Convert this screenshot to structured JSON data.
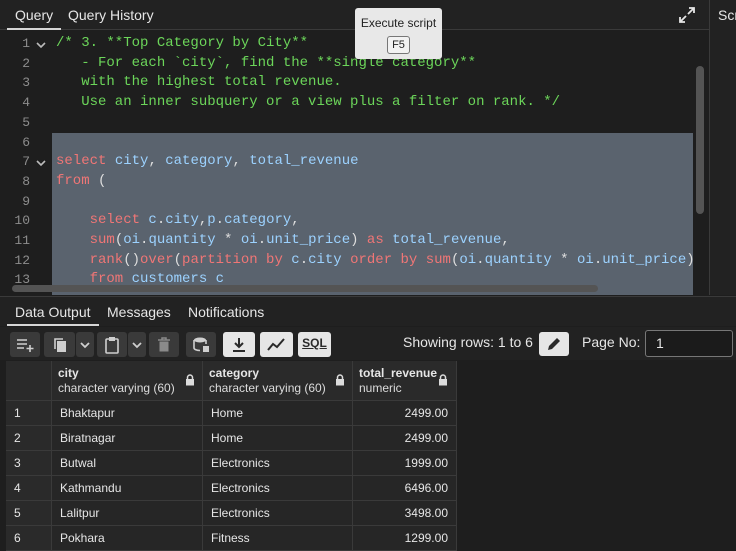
{
  "tabs": {
    "query": "Query",
    "history": "Query History",
    "right_partial": "Scratch"
  },
  "tooltip": {
    "text": "Execute script",
    "key": "F5"
  },
  "editor": {
    "line_numbers": [
      "1",
      "2",
      "3",
      "4",
      "5",
      "6",
      "7",
      "8",
      "9",
      "10",
      "11",
      "12",
      "13"
    ],
    "lines": [
      [
        {
          "t": "/* 3. **Top Category by City**",
          "c": "cmt"
        }
      ],
      [
        {
          "t": "   - For each `city`, find the **single category**",
          "c": "cmt"
        }
      ],
      [
        {
          "t": "   with the highest total revenue.",
          "c": "cmt"
        }
      ],
      [
        {
          "t": "   Use an inner subquery or a view plus a filter on rank. */",
          "c": "cmt"
        }
      ],
      [],
      [],
      [
        {
          "t": "select",
          "c": "kw"
        },
        {
          "t": " city",
          "c": "id"
        },
        {
          "t": ",",
          "c": "pn"
        },
        {
          "t": " category",
          "c": "id"
        },
        {
          "t": ",",
          "c": "pn"
        },
        {
          "t": " total_revenue",
          "c": "id"
        }
      ],
      [
        {
          "t": "from",
          "c": "kw"
        },
        {
          "t": " (",
          "c": "pn"
        }
      ],
      [],
      [
        {
          "t": "    select",
          "c": "kw"
        },
        {
          "t": " c",
          "c": "id"
        },
        {
          "t": ".",
          "c": "pn"
        },
        {
          "t": "city",
          "c": "id"
        },
        {
          "t": ",",
          "c": "pn"
        },
        {
          "t": "p",
          "c": "id"
        },
        {
          "t": ".",
          "c": "pn"
        },
        {
          "t": "category",
          "c": "id"
        },
        {
          "t": ",",
          "c": "pn"
        }
      ],
      [
        {
          "t": "    sum",
          "c": "kw"
        },
        {
          "t": "(",
          "c": "pn"
        },
        {
          "t": "oi",
          "c": "id"
        },
        {
          "t": ".",
          "c": "pn"
        },
        {
          "t": "quantity",
          "c": "id"
        },
        {
          "t": " * ",
          "c": "pn"
        },
        {
          "t": "oi",
          "c": "id"
        },
        {
          "t": ".",
          "c": "pn"
        },
        {
          "t": "unit_price",
          "c": "id"
        },
        {
          "t": ") ",
          "c": "pn"
        },
        {
          "t": "as",
          "c": "kw"
        },
        {
          "t": " total_revenue",
          "c": "id"
        },
        {
          "t": ",",
          "c": "pn"
        }
      ],
      [
        {
          "t": "    rank",
          "c": "kw"
        },
        {
          "t": "()",
          "c": "pn"
        },
        {
          "t": "over",
          "c": "kw"
        },
        {
          "t": "(",
          "c": "pn"
        },
        {
          "t": "partition by",
          "c": "kw"
        },
        {
          "t": " c",
          "c": "id"
        },
        {
          "t": ".",
          "c": "pn"
        },
        {
          "t": "city",
          "c": "id"
        },
        {
          "t": " order by",
          "c": "kw"
        },
        {
          "t": " sum",
          "c": "kw"
        },
        {
          "t": "(",
          "c": "pn"
        },
        {
          "t": "oi",
          "c": "id"
        },
        {
          "t": ".",
          "c": "pn"
        },
        {
          "t": "quantity",
          "c": "id"
        },
        {
          "t": " * ",
          "c": "pn"
        },
        {
          "t": "oi",
          "c": "id"
        },
        {
          "t": ".",
          "c": "pn"
        },
        {
          "t": "unit_price",
          "c": "id"
        },
        {
          "t": ")",
          "c": "pn"
        }
      ],
      [
        {
          "t": "    from",
          "c": "kw"
        },
        {
          "t": " customers c",
          "c": "id"
        }
      ]
    ]
  },
  "bottom_tabs": {
    "data_output": "Data Output",
    "messages": "Messages",
    "notifications": "Notifications"
  },
  "toolbar": {
    "sql_label": "SQL",
    "showing_rows": "Showing rows: 1 to 6",
    "page_no_label": "Page No:",
    "page_no_value": "1"
  },
  "results": {
    "columns": [
      {
        "name": "city",
        "type": "character varying (60)"
      },
      {
        "name": "category",
        "type": "character varying (60)"
      },
      {
        "name": "total_revenue",
        "type": "numeric"
      }
    ],
    "rows": [
      [
        "1",
        "Bhaktapur",
        "Home",
        "2499.00"
      ],
      [
        "2",
        "Biratnagar",
        "Home",
        "2499.00"
      ],
      [
        "3",
        "Butwal",
        "Electronics",
        "1999.00"
      ],
      [
        "4",
        "Kathmandu",
        "Electronics",
        "6496.00"
      ],
      [
        "5",
        "Lalitpur",
        "Electronics",
        "3498.00"
      ],
      [
        "6",
        "Pokhara",
        "Fitness",
        "1299.00"
      ]
    ]
  }
}
